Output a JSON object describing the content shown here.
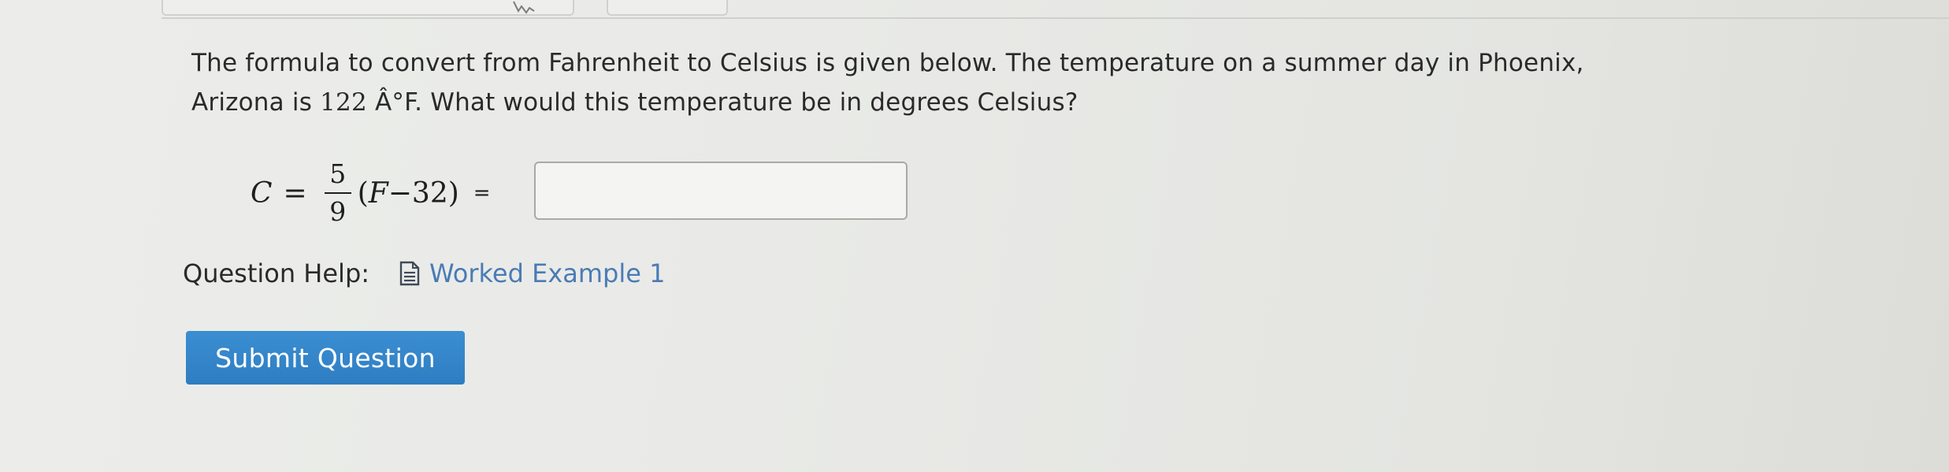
{
  "question": {
    "text_before": "The formula to convert from Fahrenheit to Celsius is given below. The temperature on a summer day in Phoenix, Arizona is ",
    "temperature_value": "122",
    "text_after": " Â°F. What would this temperature be in degrees Celsius?"
  },
  "formula": {
    "lhs": "C",
    "equals": "=",
    "numerator": "5",
    "denominator": "9",
    "open_paren": "(",
    "variable": "F",
    "minus": " − ",
    "constant": "32",
    "close_paren": ")",
    "trailing_equals": "="
  },
  "answer": {
    "value": "",
    "placeholder": ""
  },
  "help": {
    "label": "Question Help:",
    "icon": "document-icon",
    "link_label": "Worked Example 1"
  },
  "submit": {
    "label": "Submit Question"
  },
  "colors": {
    "link": "#4a7bb5",
    "button": "#2e7dc2",
    "background": "#e9eae7"
  }
}
